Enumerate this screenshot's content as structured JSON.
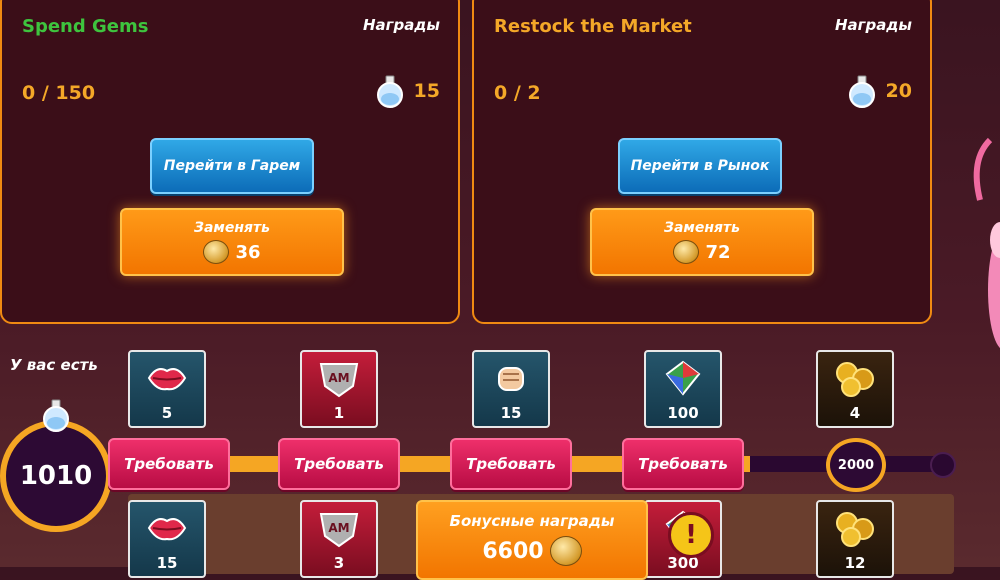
{
  "tasks": [
    {
      "title": "Spend Gems",
      "title_color": "#3ec43e",
      "rewards_label": "Награды",
      "progress": "0 / 150",
      "reward_amount": "15",
      "go_button": "Перейти в Гарем",
      "replace_button": "Заменять",
      "replace_cost": "36"
    },
    {
      "title": "Restock the Market",
      "title_color": "#f4a828",
      "rewards_label": "Награды",
      "progress": "0 / 2",
      "reward_amount": "20",
      "go_button": "Перейти в Рынок",
      "replace_button": "Заменять",
      "replace_cost": "72"
    }
  ],
  "you_have": {
    "label": "У вас есть",
    "value": "1010"
  },
  "track": {
    "milestone": "2000",
    "claim_label": "Требовать"
  },
  "free_rewards": [
    {
      "icon": "lips-icon",
      "amount": "5"
    },
    {
      "icon": "am-badge-icon",
      "amount": "1"
    },
    {
      "icon": "fist-icon",
      "amount": "15"
    },
    {
      "icon": "gem-icon",
      "amount": "100"
    },
    {
      "icon": "gold-coins-icon",
      "amount": "4"
    }
  ],
  "bonus_rewards": [
    {
      "icon": "lips-icon",
      "amount": "15"
    },
    {
      "icon": "am-badge-icon",
      "amount": "3"
    },
    {
      "icon": "gem-icon",
      "amount": "300"
    },
    {
      "icon": "gold-coins-icon",
      "amount": "12"
    }
  ],
  "bonus": {
    "label": "Бонусные награды",
    "cost": "6600"
  },
  "colors": {
    "accent_orange": "#f5a623",
    "claim_pink": "#d81b55",
    "button_blue": "#1c8fd6"
  }
}
